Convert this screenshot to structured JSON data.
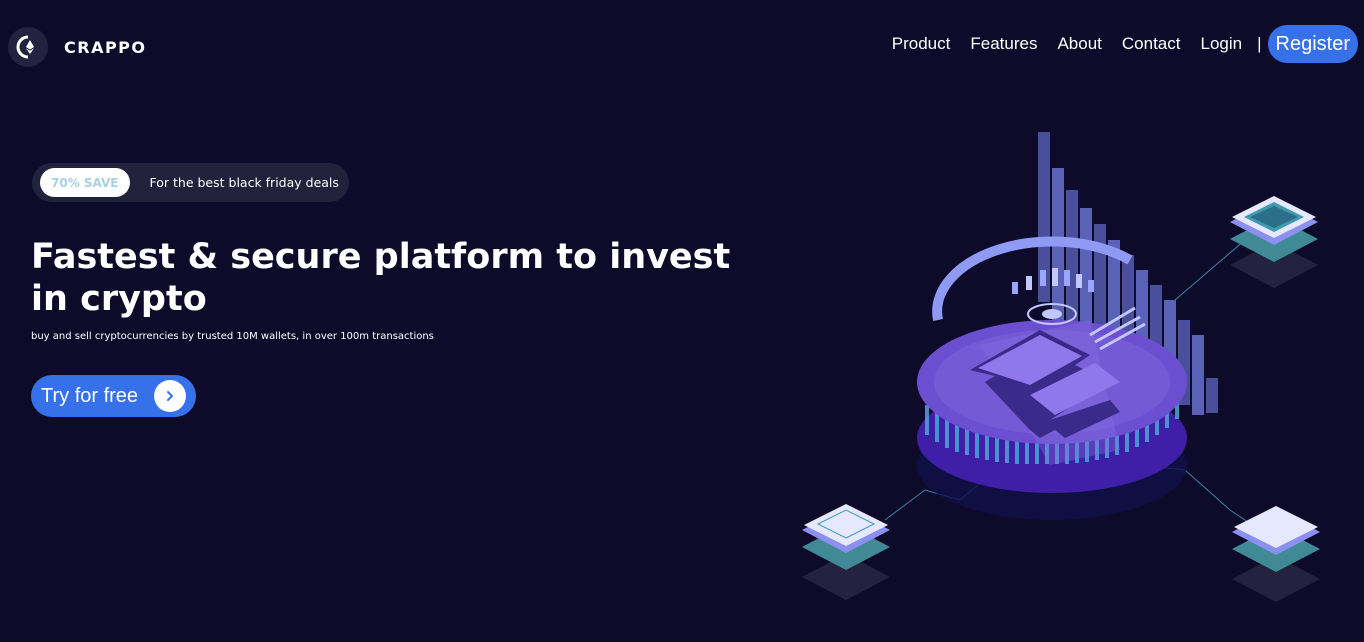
{
  "header": {
    "brand": "CRAPPO",
    "nav": [
      {
        "label": "Product"
      },
      {
        "label": "Features"
      },
      {
        "label": "About"
      },
      {
        "label": "Contact"
      },
      {
        "label": "Login"
      }
    ],
    "separator": "|",
    "register_label": "Register"
  },
  "promo": {
    "badge": "70% SAVE",
    "text": "For the best black friday deals"
  },
  "hero": {
    "title": "Fastest & secure platform to invest in crypto",
    "subtitle": "buy and sell cryptocurrencies by trusted 10M wallets, in over 100m transactions",
    "cta_label": "Try for free"
  },
  "icons": {
    "logo": "ethereum-logo-icon",
    "cta_arrow": "chevron-right-icon",
    "illustration": "bitcoin-coin-illustration"
  },
  "colors": {
    "background": "#0d0b29",
    "accent": "#3671e9",
    "badge_text": "#a7d1e3",
    "coin": "#6c4fd0"
  }
}
